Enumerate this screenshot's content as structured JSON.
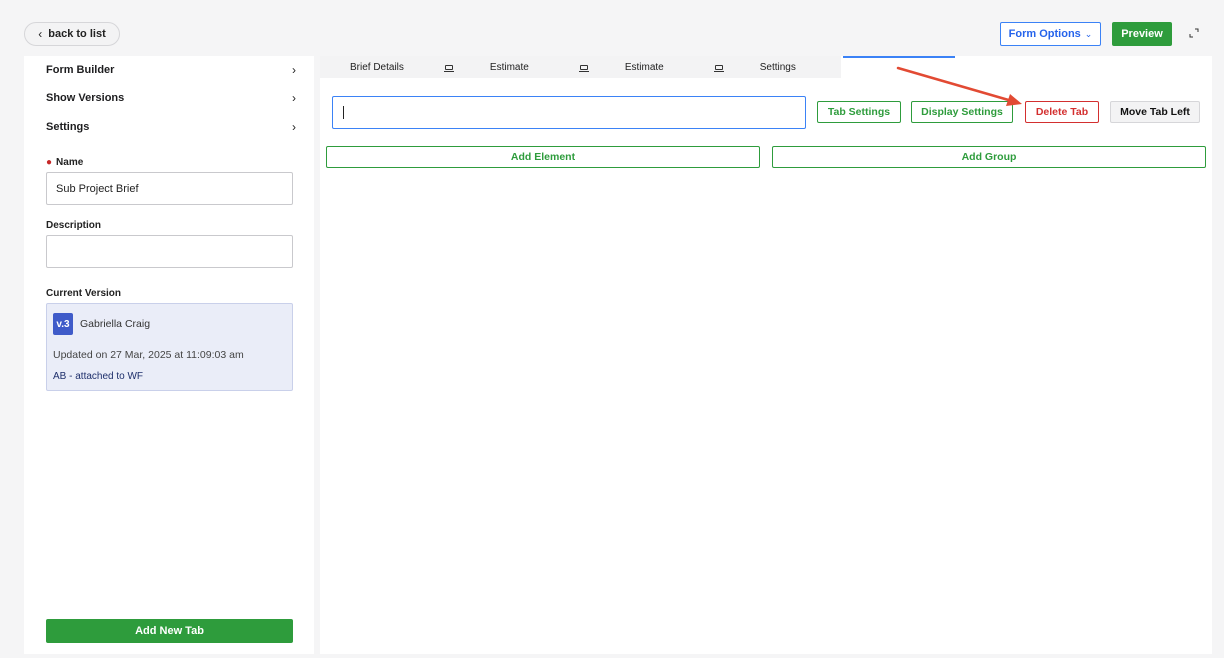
{
  "header": {
    "back_label": "back to list",
    "form_options_label": "Form Options",
    "preview_label": "Preview"
  },
  "sidebar": {
    "menu": [
      {
        "label": "Form Builder"
      },
      {
        "label": "Show Versions"
      },
      {
        "label": "Settings"
      }
    ],
    "name_label": "Name",
    "name_value": "Sub Project Brief",
    "description_label": "Description",
    "description_value": "",
    "current_version_label": "Current Version",
    "version": {
      "badge": "v.3",
      "author": "Gabriella Craig",
      "updated": "Updated on 27 Mar, 2025 at 11:09:03 am",
      "note": "AB - attached to WF"
    },
    "add_tab_label": "Add New Tab"
  },
  "main": {
    "tabs": [
      {
        "label": "Brief Details"
      },
      {
        "label": "Estimate"
      },
      {
        "label": "Estimate"
      },
      {
        "label": "Settings"
      }
    ],
    "tab_name_value": "",
    "buttons": {
      "tab_settings": "Tab Settings",
      "display_settings": "Display Settings",
      "delete_tab": "Delete Tab",
      "move_tab_left": "Move Tab Left"
    },
    "add_element_label": "Add Element",
    "add_group_label": "Add Group"
  },
  "colors": {
    "accent_green": "#2e9c3c",
    "accent_blue": "#3b82f6",
    "danger_red": "#d32f2f",
    "annotation_arrow": "#e24a33"
  }
}
